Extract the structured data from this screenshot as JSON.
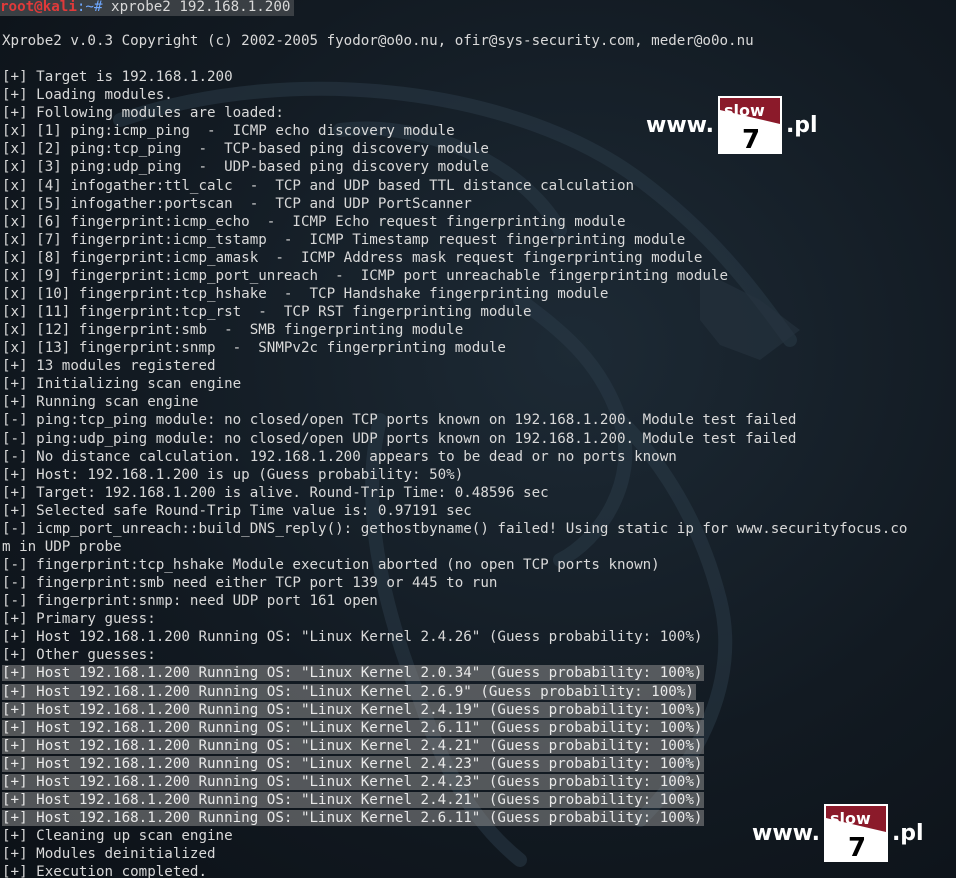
{
  "prompt": {
    "user": "root@kali",
    "path": ":~#",
    "command": " xprobe2 192.168.1.200"
  },
  "lines": [
    "Xprobe2 v.0.3 Copyright (c) 2002-2005 fyodor@o0o.nu, ofir@sys-security.com, meder@o0o.nu",
    "",
    "[+] Target is 192.168.1.200",
    "[+] Loading modules.",
    "[+] Following modules are loaded:",
    "[x] [1] ping:icmp_ping  -  ICMP echo discovery module",
    "[x] [2] ping:tcp_ping  -  TCP-based ping discovery module",
    "[x] [3] ping:udp_ping  -  UDP-based ping discovery module",
    "[x] [4] infogather:ttl_calc  -  TCP and UDP based TTL distance calculation",
    "[x] [5] infogather:portscan  -  TCP and UDP PortScanner",
    "[x] [6] fingerprint:icmp_echo  -  ICMP Echo request fingerprinting module",
    "[x] [7] fingerprint:icmp_tstamp  -  ICMP Timestamp request fingerprinting module",
    "[x] [8] fingerprint:icmp_amask  -  ICMP Address mask request fingerprinting module",
    "[x] [9] fingerprint:icmp_port_unreach  -  ICMP port unreachable fingerprinting module",
    "[x] [10] fingerprint:tcp_hshake  -  TCP Handshake fingerprinting module",
    "[x] [11] fingerprint:tcp_rst  -  TCP RST fingerprinting module",
    "[x] [12] fingerprint:smb  -  SMB fingerprinting module",
    "[x] [13] fingerprint:snmp  -  SNMPv2c fingerprinting module",
    "[+] 13 modules registered",
    "[+] Initializing scan engine",
    "[+] Running scan engine",
    "[-] ping:tcp_ping module: no closed/open TCP ports known on 192.168.1.200. Module test failed",
    "[-] ping:udp_ping module: no closed/open UDP ports known on 192.168.1.200. Module test failed",
    "[-] No distance calculation. 192.168.1.200 appears to be dead or no ports known",
    "[+] Host: 192.168.1.200 is up (Guess probability: 50%)",
    "[+] Target: 192.168.1.200 is alive. Round-Trip Time: 0.48596 sec",
    "[+] Selected safe Round-Trip Time value is: 0.97191 sec",
    "[-] icmp_port_unreach::build_DNS_reply(): gethostbyname() failed! Using static ip for www.securityfocus.co",
    "m in UDP probe",
    "[-] fingerprint:tcp_hshake Module execution aborted (no open TCP ports known)",
    "[-] fingerprint:smb need either TCP port 139 or 445 to run",
    "[-] fingerprint:snmp: need UDP port 161 open",
    "[+] Primary guess:",
    "[+] Host 192.168.1.200 Running OS: \"Linux Kernel 2.4.26\" (Guess probability: 100%)",
    "[+] Other guesses:",
    "[+] Host 192.168.1.200 Running OS: \"Linux Kernel 2.0.34\" (Guess probability: 100%)",
    "[+] Host 192.168.1.200 Running OS: \"Linux Kernel 2.6.9\" (Guess probability: 100%)",
    "[+] Host 192.168.1.200 Running OS: \"Linux Kernel 2.4.19\" (Guess probability: 100%)",
    "[+] Host 192.168.1.200 Running OS: \"Linux Kernel 2.6.11\" (Guess probability: 100%)",
    "[+] Host 192.168.1.200 Running OS: \"Linux Kernel 2.4.21\" (Guess probability: 100%)",
    "[+] Host 192.168.1.200 Running OS: \"Linux Kernel 2.4.23\" (Guess probability: 100%)",
    "[+] Host 192.168.1.200 Running OS: \"Linux Kernel 2.4.23\" (Guess probability: 100%)",
    "[+] Host 192.168.1.200 Running OS: \"Linux Kernel 2.4.21\" (Guess probability: 100%)",
    "[+] Host 192.168.1.200 Running OS: \"Linux Kernel 2.6.11\" (Guess probability: 100%)",
    "[+] Cleaning up scan engine",
    "[+] Modules deinitialized",
    "[+] Execution completed."
  ],
  "highlighted_lines": [
    35,
    36,
    37,
    38,
    39,
    40,
    41,
    42,
    43
  ],
  "watermark": {
    "prefix": "www.",
    "badge_top": "slow",
    "badge_num": "7",
    "suffix": ".pl"
  },
  "colors": {
    "prompt_user": "#e03a3a",
    "prompt_path": "#6fa8ff",
    "text": "#d9d9d9",
    "highlight": "#8c8c8c",
    "badge_red": "#8b1a2a"
  }
}
